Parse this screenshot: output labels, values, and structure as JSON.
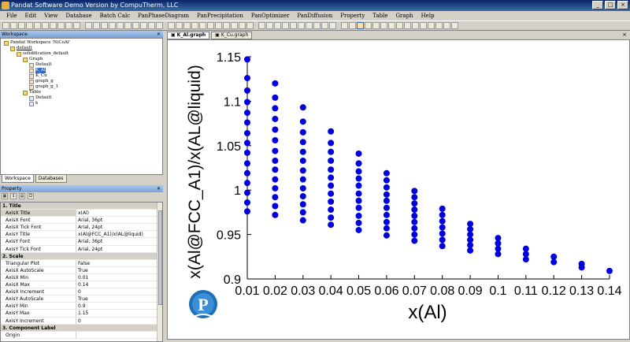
{
  "window": {
    "title": "Pandat Software Demo Version by CompuTherm, LLC",
    "controls": [
      "_",
      "□",
      "×"
    ]
  },
  "menu": [
    "File",
    "Edit",
    "View",
    "Database",
    "Batch Calc",
    "PanPhaseDiagram",
    "PanPrecipitation",
    "PanOptimizer",
    "PanDiffusion",
    "Property",
    "Table",
    "Graph",
    "Help"
  ],
  "workspace": {
    "title": "Workspace",
    "tree": [
      {
        "label": "Pandat Workspace 'NiCoAl'",
        "level": 0,
        "kind": "folder"
      },
      {
        "label": "default",
        "level": 1,
        "kind": "folder",
        "link": true
      },
      {
        "label": "solidification_default",
        "level": 2,
        "kind": "folder"
      },
      {
        "label": "Graph",
        "level": 3,
        "kind": "folder"
      },
      {
        "label": "Default",
        "level": 4,
        "kind": "graph"
      },
      {
        "label": "K_Al",
        "level": 4,
        "kind": "graph",
        "selected": true
      },
      {
        "label": "K_Cu",
        "level": 4,
        "kind": "graph"
      },
      {
        "label": "graph_g",
        "level": 4,
        "kind": "graph"
      },
      {
        "label": "graph_g_1",
        "level": 4,
        "kind": "graph"
      },
      {
        "label": "Table",
        "level": 3,
        "kind": "folder"
      },
      {
        "label": "Default",
        "level": 4,
        "kind": "table"
      },
      {
        "label": "k",
        "level": 4,
        "kind": "table"
      }
    ],
    "tabs": [
      "Workspace",
      "Databases"
    ]
  },
  "property": {
    "title": "Property",
    "rows": [
      {
        "section": true,
        "key": "1. Title"
      },
      {
        "key": "AxisX Title",
        "value": "x(Al)",
        "selected": true
      },
      {
        "key": "AxisX Font",
        "value": "Arial, 36pt"
      },
      {
        "key": "AxisX Tick Font",
        "value": "Arial, 24pt"
      },
      {
        "key": "AxisY Title",
        "value": "x(Al@FCC_A1)/x(AL@liquid)"
      },
      {
        "key": "AxisY Font",
        "value": "Arial, 36pt"
      },
      {
        "key": "AxisY Tick Font",
        "value": "Arial, 24pt"
      },
      {
        "section": true,
        "key": "2. Scale"
      },
      {
        "key": "Triangular Plot",
        "value": "False"
      },
      {
        "key": "AxisX AutoScale",
        "value": "True"
      },
      {
        "key": "AxisX Min",
        "value": "0.01"
      },
      {
        "key": "AxisX Max",
        "value": "0.14"
      },
      {
        "key": "AxisX Increment",
        "value": "0"
      },
      {
        "key": "AxisY AutoScale",
        "value": "True"
      },
      {
        "key": "AxisY Min",
        "value": "0.9"
      },
      {
        "key": "AxisY Max",
        "value": "1.15"
      },
      {
        "key": "AxisY Increment",
        "value": "0"
      },
      {
        "section": true,
        "key": "3. Component Label"
      },
      {
        "key": "Origin",
        "value": ""
      }
    ]
  },
  "docTabs": [
    "K_Al.graph",
    "K_Cu.graph"
  ],
  "chart_data": {
    "type": "scatter",
    "xlabel": "x(Al)",
    "ylabel": "x(Al@FCC_A1)/x(AL@liquid)",
    "xlim": [
      0.01,
      0.14
    ],
    "ylim": [
      0.9,
      1.15
    ],
    "xticks": [
      "0.01",
      "0.02",
      "0.03",
      "0.04",
      "0.05",
      "0.06",
      "0.07",
      "0.08",
      "0.09",
      "0.1",
      "0.11",
      "0.12",
      "0.13",
      "0.14"
    ],
    "yticks": [
      "0.9",
      "0.95",
      "1",
      "1.05",
      "1.1",
      "1.15"
    ],
    "color": "#0000dd",
    "series": [
      {
        "x": 0.01,
        "y": [
          0.976,
          0.986,
          0.997,
          1.008,
          1.019,
          1.03,
          1.042,
          1.053,
          1.064,
          1.076,
          1.087,
          1.099,
          1.112,
          1.126,
          1.147
        ]
      },
      {
        "x": 0.02,
        "y": [
          0.972,
          0.982,
          0.992,
          1.002,
          1.012,
          1.023,
          1.033,
          1.044,
          1.056,
          1.068,
          1.08,
          1.092,
          1.104,
          1.12
        ]
      },
      {
        "x": 0.03,
        "y": [
          0.966,
          0.975,
          0.984,
          0.993,
          1.002,
          1.012,
          1.022,
          1.033,
          1.043,
          1.054,
          1.065,
          1.077,
          1.093
        ]
      },
      {
        "x": 0.04,
        "y": [
          0.961,
          0.969,
          0.978,
          0.987,
          0.996,
          1.005,
          1.014,
          1.023,
          1.033,
          1.043,
          1.053,
          1.066
        ]
      },
      {
        "x": 0.05,
        "y": [
          0.955,
          0.963,
          0.971,
          0.98,
          0.988,
          0.996,
          1.005,
          1.013,
          1.021,
          1.03,
          1.041
        ]
      },
      {
        "x": 0.06,
        "y": [
          0.949,
          0.957,
          0.964,
          0.972,
          0.98,
          0.988,
          0.995,
          1.003,
          1.011,
          1.019
        ]
      },
      {
        "x": 0.07,
        "y": [
          0.943,
          0.95,
          0.957,
          0.964,
          0.971,
          0.978,
          0.985,
          0.992,
          0.999
        ]
      },
      {
        "x": 0.08,
        "y": [
          0.937,
          0.944,
          0.951,
          0.958,
          0.965,
          0.972,
          0.979
        ]
      },
      {
        "x": 0.09,
        "y": [
          0.932,
          0.938,
          0.944,
          0.95,
          0.956,
          0.962
        ]
      },
      {
        "x": 0.1,
        "y": [
          0.928,
          0.934,
          0.94,
          0.946
        ]
      },
      {
        "x": 0.11,
        "y": [
          0.922,
          0.928,
          0.934
        ]
      },
      {
        "x": 0.12,
        "y": [
          0.919,
          0.925
        ]
      },
      {
        "x": 0.13,
        "y": [
          0.913,
          0.917
        ]
      },
      {
        "x": 0.14,
        "y": [
          0.909
        ]
      }
    ]
  }
}
